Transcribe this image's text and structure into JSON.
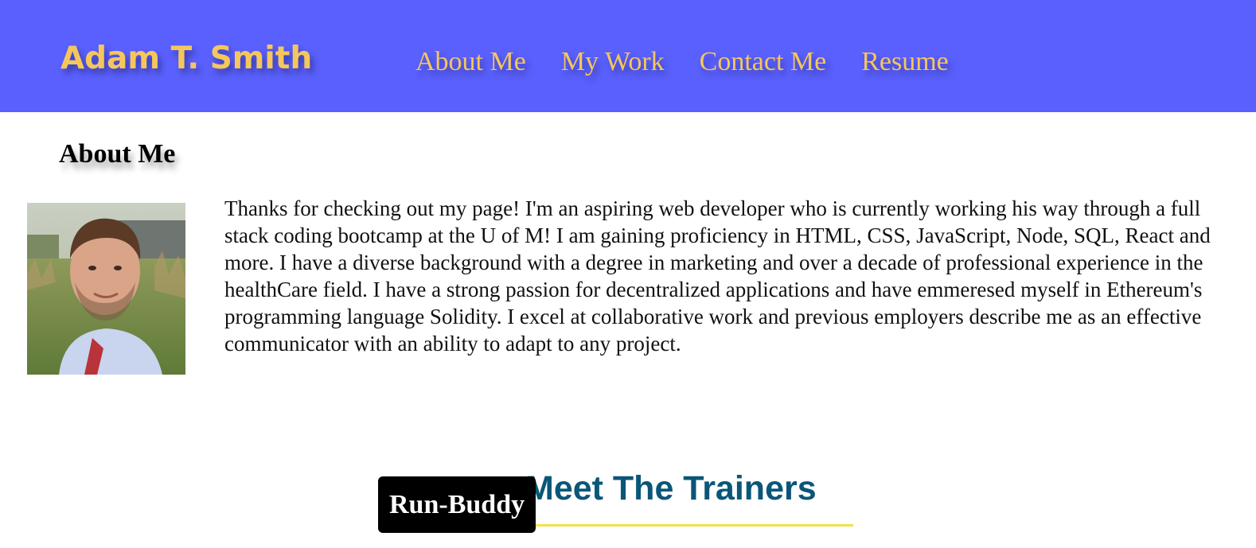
{
  "header": {
    "brand": "Adam T. Smith",
    "nav": [
      "About Me",
      "My Work",
      "Contact Me",
      "Resume"
    ]
  },
  "about": {
    "title": "About Me",
    "bio": "Thanks for checking out my page! I'm an aspiring web developer who is currently working his way through a full stack coding bootcamp at the U of M! I am gaining proficiency in HTML, CSS, JavaScript, Node, SQL, React and more. I have a diverse background with a degree in marketing and over a decade of professional experience in the healthCare field. I have a strong passion for decentralized applications and have emmeresed myself in Ethereum's programming language Solidity. I excel at collaborative work and previous employers describe me as an effective communicator with an ability to adapt to any project."
  },
  "work": {
    "project": {
      "label": "Run-Buddy",
      "preview_heading": "Meet The Trainers"
    }
  },
  "colors": {
    "header_bg": "#5a60fd",
    "accent": "#f5c75b",
    "preview_heading": "#0a5678",
    "preview_underline": "#f4e04d"
  }
}
